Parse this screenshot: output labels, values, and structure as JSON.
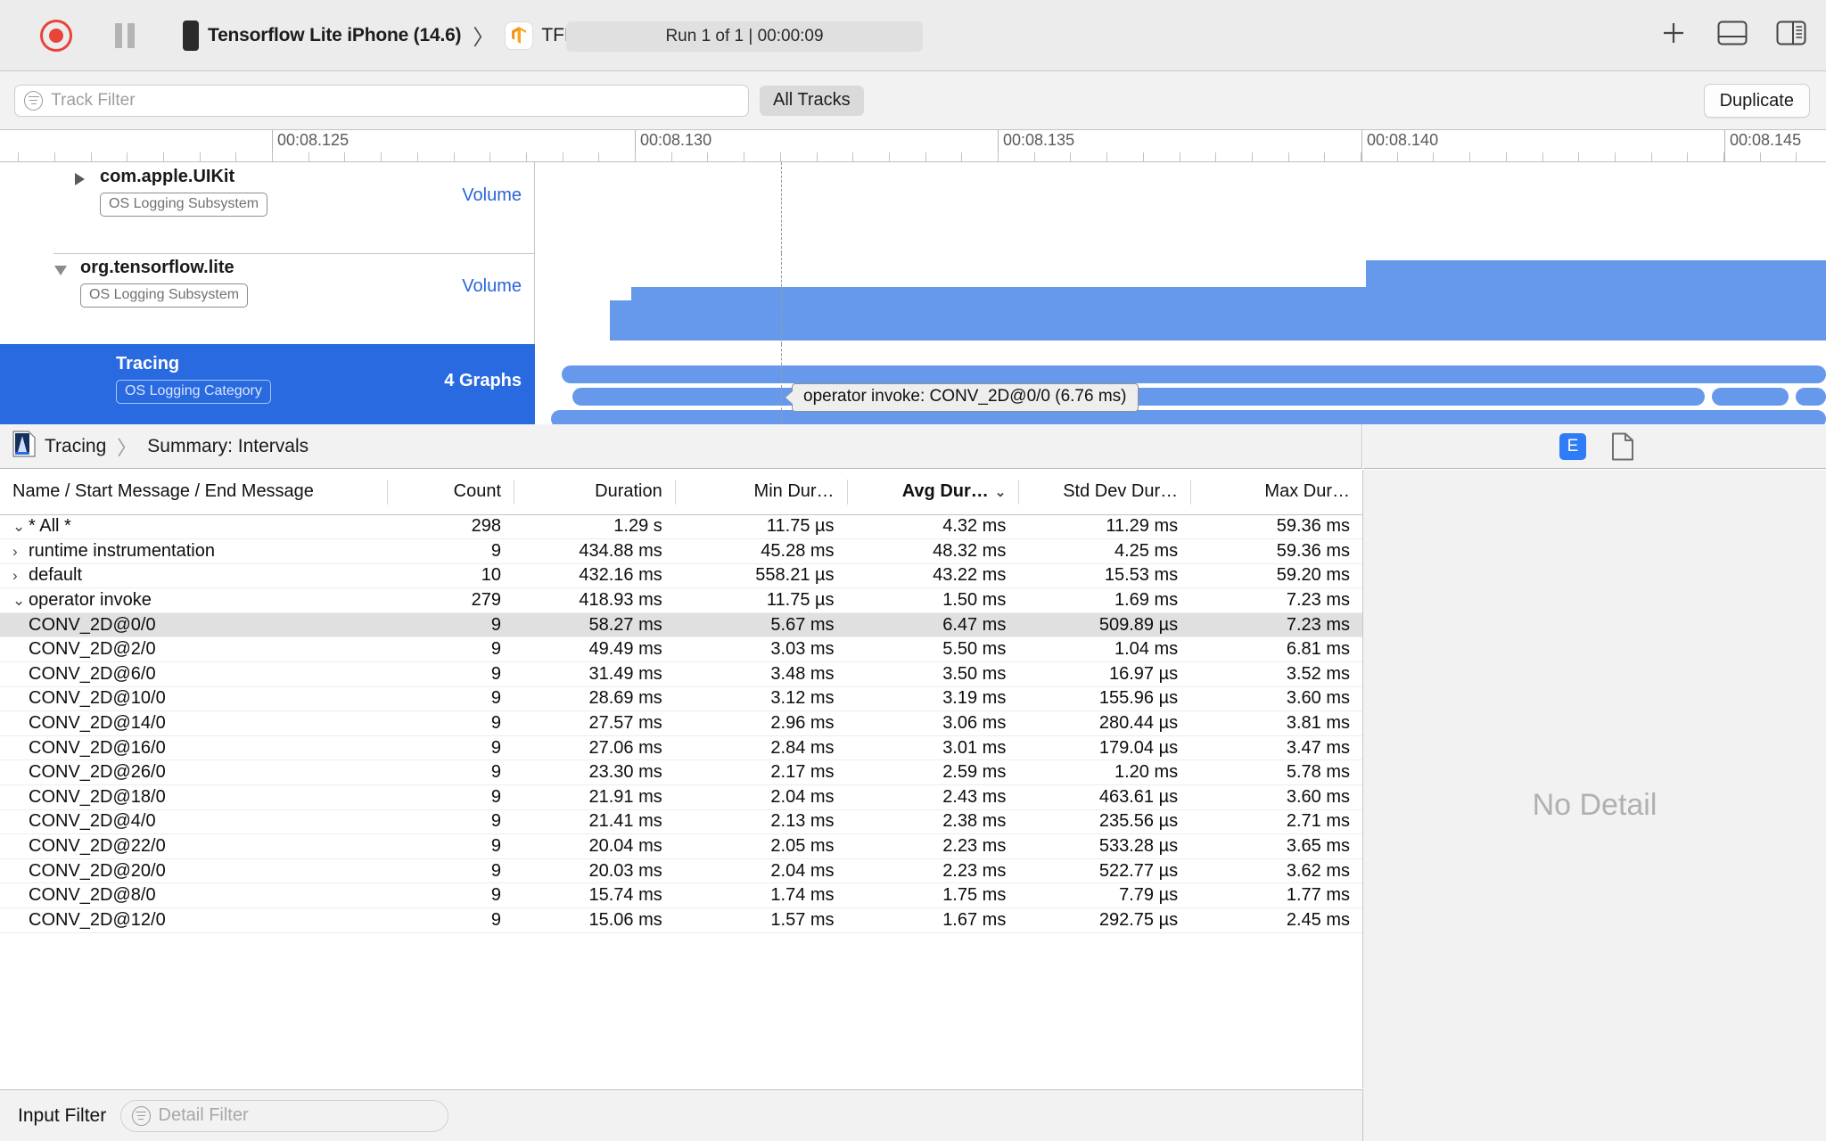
{
  "toolbar": {
    "record_icon": "record-circle-icon",
    "pause_icon": "pause-icon",
    "device_icon": "iphone-icon",
    "device_label": "Tensorflow Lite iPhone (14.6)",
    "breadcrumb_separator": "〉",
    "app_icon": "tensorflow-app-icon",
    "app_label": "TFL Classify",
    "run_status": "Run 1 of 1  |  00:00:09",
    "add_icon": "plus-icon",
    "layout_icon": "horizontal-split-icon",
    "inspector_icon": "right-sidebar-icon"
  },
  "filterbar": {
    "track_filter_placeholder": "Track Filter",
    "track_filter_value": "",
    "filter_icon": "filter-funnel-icon",
    "all_tracks_label": "All Tracks",
    "duplicate_label": "Duplicate"
  },
  "ruler": {
    "ticks": [
      "00:08.125",
      "00:08.130",
      "00:08.135",
      "00:08.140",
      "00:08.145"
    ]
  },
  "tracks": [
    {
      "name": "com.apple.UIKit",
      "badge": "OS Logging Subsystem",
      "right_label": "Volume",
      "expanded": false,
      "disclosure_icon": "triangle-right-icon"
    },
    {
      "name": "org.tensorflow.lite",
      "badge": "OS Logging Subsystem",
      "right_label": "Volume",
      "expanded": true,
      "disclosure_icon": "triangle-down-icon"
    },
    {
      "name": "Tracing",
      "badge": "OS Logging Category",
      "right_label": "4 Graphs",
      "expanded": true,
      "selected": true,
      "disclosure_icon": "none"
    }
  ],
  "tooltip": {
    "text": "operator invoke: CONV_2D@0/0 (6.76 ms)"
  },
  "detail": {
    "breadcrumb_icon": "instrument-icon",
    "breadcrumb_root": "Tracing",
    "breadcrumb_sep": "〉",
    "breadcrumb_leaf": "Summary: Intervals",
    "extension_badge": "E",
    "document_icon": "document-icon",
    "no_detail": "No Detail"
  },
  "table": {
    "columns": [
      {
        "label": "Name / Start Message / End Message",
        "sorted": false
      },
      {
        "label": "Count",
        "sorted": false
      },
      {
        "label": "Duration",
        "sorted": false
      },
      {
        "label": "Min Dur…",
        "sorted": false
      },
      {
        "label": "Avg Dur…",
        "sorted": true,
        "sort_caret": "⌄"
      },
      {
        "label": "Std Dev Dur…",
        "sorted": false
      },
      {
        "label": "Max Dur…",
        "sorted": false
      }
    ],
    "rows": [
      {
        "arrow": "⌄",
        "indent": 0,
        "name": "* All *",
        "count": "298",
        "duration": "1.29 s",
        "min": "11.75 µs",
        "avg": "4.32 ms",
        "std": "11.29 ms",
        "max": "59.36 ms",
        "selected": false
      },
      {
        "arrow": "›",
        "indent": 1,
        "name": "runtime instrumentation",
        "count": "9",
        "duration": "434.88 ms",
        "min": "45.28 ms",
        "avg": "48.32 ms",
        "std": "4.25 ms",
        "max": "59.36 ms",
        "selected": false
      },
      {
        "arrow": "›",
        "indent": 1,
        "name": "default",
        "count": "10",
        "duration": "432.16 ms",
        "min": "558.21 µs",
        "avg": "43.22 ms",
        "std": "15.53 ms",
        "max": "59.20 ms",
        "selected": false
      },
      {
        "arrow": "⌄",
        "indent": 1,
        "name": "operator invoke",
        "count": "279",
        "duration": "418.93 ms",
        "min": "11.75 µs",
        "avg": "1.50 ms",
        "std": "1.69 ms",
        "max": "7.23 ms",
        "selected": false
      },
      {
        "arrow": "",
        "indent": 2,
        "name": "CONV_2D@0/0",
        "count": "9",
        "duration": "58.27 ms",
        "min": "5.67 ms",
        "avg": "6.47 ms",
        "std": "509.89 µs",
        "max": "7.23 ms",
        "selected": true
      },
      {
        "arrow": "",
        "indent": 2,
        "name": "CONV_2D@2/0",
        "count": "9",
        "duration": "49.49 ms",
        "min": "3.03 ms",
        "avg": "5.50 ms",
        "std": "1.04 ms",
        "max": "6.81 ms",
        "selected": false
      },
      {
        "arrow": "",
        "indent": 2,
        "name": "CONV_2D@6/0",
        "count": "9",
        "duration": "31.49 ms",
        "min": "3.48 ms",
        "avg": "3.50 ms",
        "std": "16.97 µs",
        "max": "3.52 ms",
        "selected": false
      },
      {
        "arrow": "",
        "indent": 2,
        "name": "CONV_2D@10/0",
        "count": "9",
        "duration": "28.69 ms",
        "min": "3.12 ms",
        "avg": "3.19 ms",
        "std": "155.96 µs",
        "max": "3.60 ms",
        "selected": false
      },
      {
        "arrow": "",
        "indent": 2,
        "name": "CONV_2D@14/0",
        "count": "9",
        "duration": "27.57 ms",
        "min": "2.96 ms",
        "avg": "3.06 ms",
        "std": "280.44 µs",
        "max": "3.81 ms",
        "selected": false
      },
      {
        "arrow": "",
        "indent": 2,
        "name": "CONV_2D@16/0",
        "count": "9",
        "duration": "27.06 ms",
        "min": "2.84 ms",
        "avg": "3.01 ms",
        "std": "179.04 µs",
        "max": "3.47 ms",
        "selected": false
      },
      {
        "arrow": "",
        "indent": 2,
        "name": "CONV_2D@26/0",
        "count": "9",
        "duration": "23.30 ms",
        "min": "2.17 ms",
        "avg": "2.59 ms",
        "std": "1.20 ms",
        "max": "5.78 ms",
        "selected": false
      },
      {
        "arrow": "",
        "indent": 2,
        "name": "CONV_2D@18/0",
        "count": "9",
        "duration": "21.91 ms",
        "min": "2.04 ms",
        "avg": "2.43 ms",
        "std": "463.61 µs",
        "max": "3.60 ms",
        "selected": false
      },
      {
        "arrow": "",
        "indent": 2,
        "name": "CONV_2D@4/0",
        "count": "9",
        "duration": "21.41 ms",
        "min": "2.13 ms",
        "avg": "2.38 ms",
        "std": "235.56 µs",
        "max": "2.71 ms",
        "selected": false
      },
      {
        "arrow": "",
        "indent": 2,
        "name": "CONV_2D@22/0",
        "count": "9",
        "duration": "20.04 ms",
        "min": "2.05 ms",
        "avg": "2.23 ms",
        "std": "533.28 µs",
        "max": "3.65 ms",
        "selected": false
      },
      {
        "arrow": "",
        "indent": 2,
        "name": "CONV_2D@20/0",
        "count": "9",
        "duration": "20.03 ms",
        "min": "2.04 ms",
        "avg": "2.23 ms",
        "std": "522.77 µs",
        "max": "3.62 ms",
        "selected": false
      },
      {
        "arrow": "",
        "indent": 2,
        "name": "CONV_2D@8/0",
        "count": "9",
        "duration": "15.74 ms",
        "min": "1.74 ms",
        "avg": "1.75 ms",
        "std": "7.79 µs",
        "max": "1.77 ms",
        "selected": false
      },
      {
        "arrow": "",
        "indent": 2,
        "name": "CONV_2D@12/0",
        "count": "9",
        "duration": "15.06 ms",
        "min": "1.57 ms",
        "avg": "1.67 ms",
        "std": "292.75 µs",
        "max": "2.45 ms",
        "selected": false
      }
    ]
  },
  "bottom": {
    "input_filter_label": "Input Filter",
    "detail_filter_placeholder": "Detail Filter",
    "detail_filter_value": "",
    "filter_icon": "filter-funnel-icon"
  },
  "colors": {
    "accent_blue": "#2a6ae0",
    "track_blue": "#6699ec",
    "record_red": "#e8443a",
    "link_blue": "#2a64d8"
  }
}
